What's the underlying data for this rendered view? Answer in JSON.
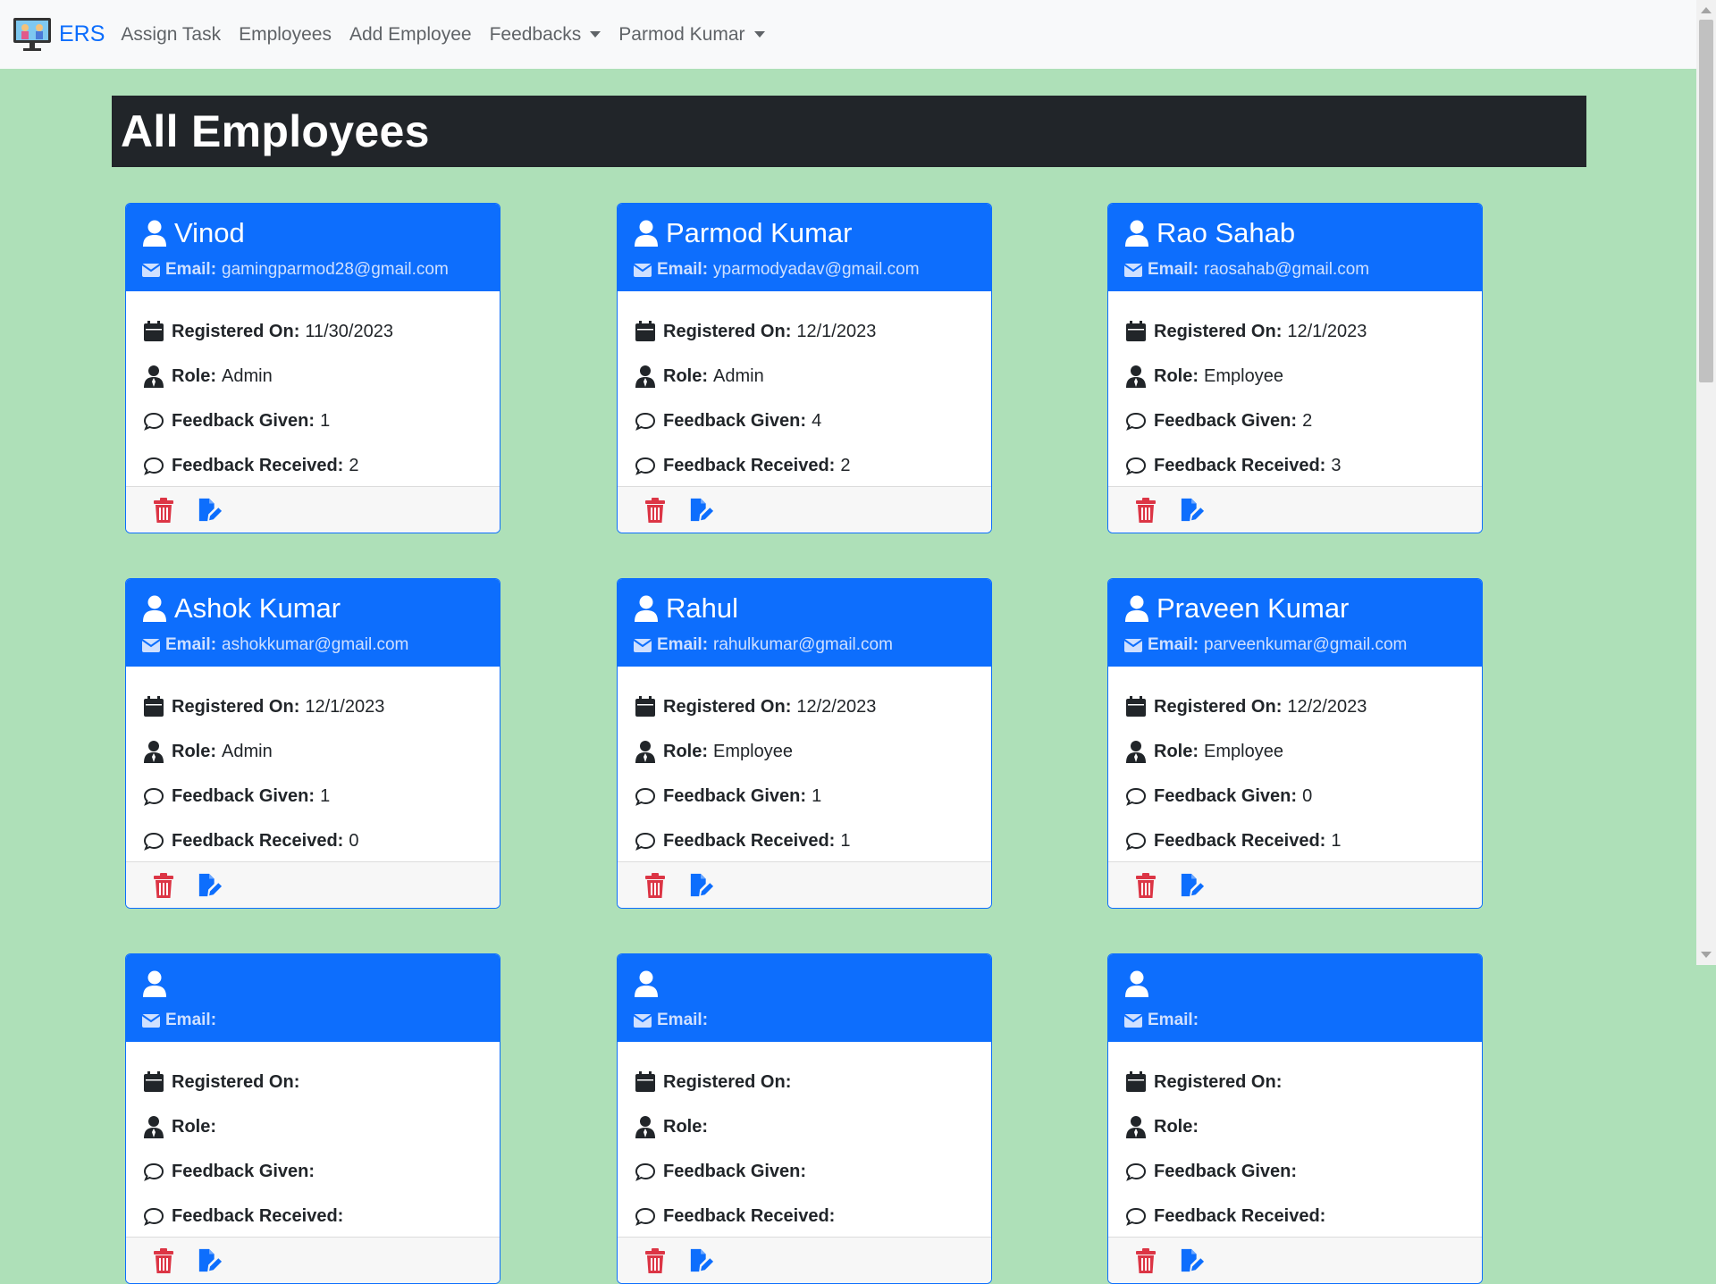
{
  "nav": {
    "brand": "ERS",
    "items": [
      {
        "label": "Assign Task"
      },
      {
        "label": "Employees"
      },
      {
        "label": "Add Employee"
      },
      {
        "label": "Feedbacks",
        "dropdown": true
      },
      {
        "label": "Parmod Kumar",
        "dropdown": true
      }
    ]
  },
  "page": {
    "title": "All Employees"
  },
  "labels": {
    "email": "Email:",
    "registered": "Registered On:",
    "role": "Role:",
    "given": "Feedback Given:",
    "received": "Feedback Received:"
  },
  "colors": {
    "primary": "#0d6efd",
    "danger": "#dc3545",
    "background": "#aee0b8",
    "dark": "#212529"
  },
  "employees": [
    {
      "name": "Vinod",
      "email": "gamingparmod28@gmail.com",
      "registered": "11/30/2023",
      "role": "Admin",
      "given": "1",
      "received": "2"
    },
    {
      "name": "Parmod Kumar",
      "email": "yparmodyadav@gmail.com",
      "registered": "12/1/2023",
      "role": "Admin",
      "given": "4",
      "received": "2"
    },
    {
      "name": "Rao Sahab",
      "email": "raosahab@gmail.com",
      "registered": "12/1/2023",
      "role": "Employee",
      "given": "2",
      "received": "3"
    },
    {
      "name": "Ashok Kumar",
      "email": "ashokkumar@gmail.com",
      "registered": "12/1/2023",
      "role": "Admin",
      "given": "1",
      "received": "0"
    },
    {
      "name": "Rahul",
      "email": "rahulkumar@gmail.com",
      "registered": "12/2/2023",
      "role": "Employee",
      "given": "1",
      "received": "1"
    },
    {
      "name": "Praveen Kumar",
      "email": "parveenkumar@gmail.com",
      "registered": "12/2/2023",
      "role": "Employee",
      "given": "0",
      "received": "1"
    }
  ]
}
